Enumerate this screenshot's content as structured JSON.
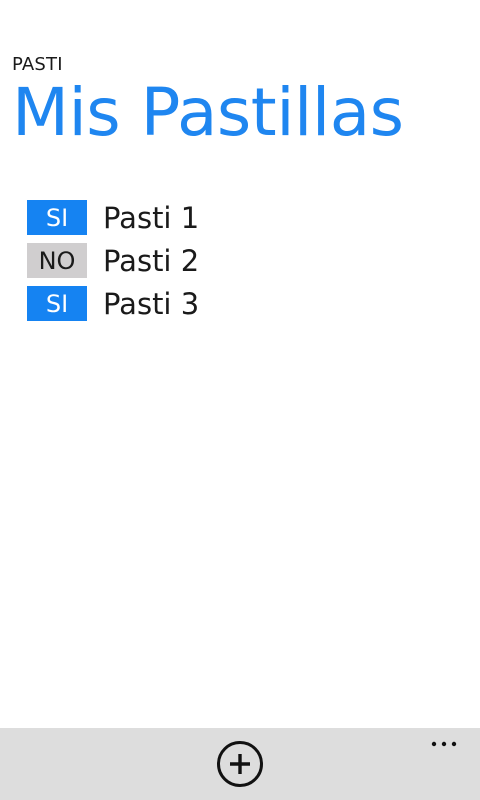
{
  "header": {
    "app_name": "PASTI",
    "page_title": "Mis Pastillas"
  },
  "pills": [
    {
      "status": "SI",
      "name": "Pasti 1"
    },
    {
      "status": "NO",
      "name": "Pasti 2"
    },
    {
      "status": "SI",
      "name": "Pasti 3"
    }
  ],
  "app_bar": {
    "add_icon": "add-circle-icon",
    "more_icon": "ellipsis-icon"
  },
  "colors": {
    "accent": "#1f86f0",
    "badge_yes": "#1583f2",
    "badge_no": "#d0cecf",
    "app_bar_bg": "#dddddd"
  }
}
